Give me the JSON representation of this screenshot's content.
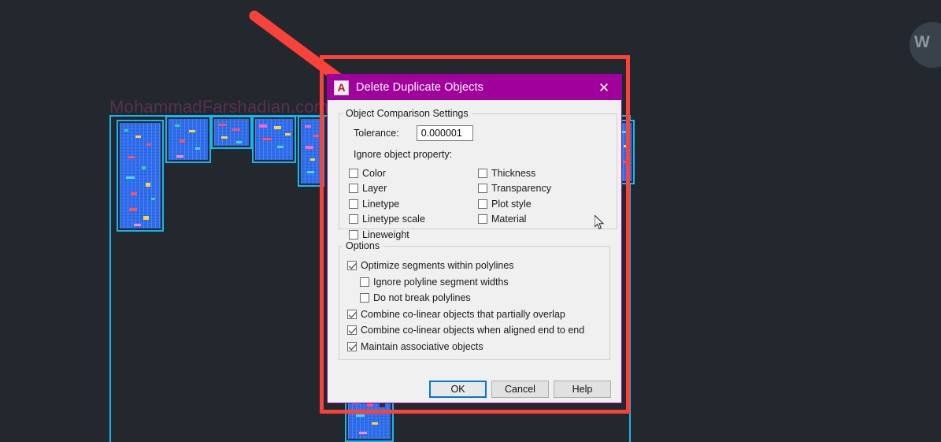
{
  "canvas": {
    "watermark": "MohammadFarshadian.com",
    "viewcube_label": "W",
    "background_color": "#22282e",
    "entity_color": "#2d6ef0",
    "outline_color": "#18b6ef"
  },
  "annotation": {
    "arrow_color": "#f9423a",
    "rect_color": "#f9423a"
  },
  "dialog": {
    "title": "Delete Duplicate Objects",
    "app_icon": "autocad-a-icon",
    "close_icon": "✕",
    "title_bar_color": "#a0009b",
    "groups": {
      "comparison": {
        "legend": "Object Comparison Settings",
        "tolerance_label": "Tolerance:",
        "tolerance_value": "0.000001",
        "ignore_label": "Ignore object property:",
        "left_column": [
          {
            "label": "Color",
            "checked": false
          },
          {
            "label": "Layer",
            "checked": false
          },
          {
            "label": "Linetype",
            "checked": false
          },
          {
            "label": "Linetype scale",
            "checked": false
          },
          {
            "label": "Lineweight",
            "checked": false
          }
        ],
        "right_column": [
          {
            "label": "Thickness",
            "checked": false
          },
          {
            "label": "Transparency",
            "checked": false
          },
          {
            "label": "Plot style",
            "checked": false
          },
          {
            "label": "Material",
            "checked": false
          }
        ]
      },
      "options": {
        "legend": "Options",
        "items": [
          {
            "label": "Optimize segments within polylines",
            "checked": true,
            "indent": false
          },
          {
            "label": "Ignore polyline segment widths",
            "checked": false,
            "indent": true
          },
          {
            "label": "Do not break polylines",
            "checked": false,
            "indent": true
          },
          {
            "label": "Combine co-linear objects that partially overlap",
            "checked": true,
            "indent": false
          },
          {
            "label": "Combine co-linear objects when aligned end to end",
            "checked": true,
            "indent": false
          },
          {
            "label": "Maintain associative objects",
            "checked": true,
            "indent": false
          }
        ]
      }
    },
    "buttons": {
      "ok": "OK",
      "cancel": "Cancel",
      "help": "Help"
    }
  }
}
